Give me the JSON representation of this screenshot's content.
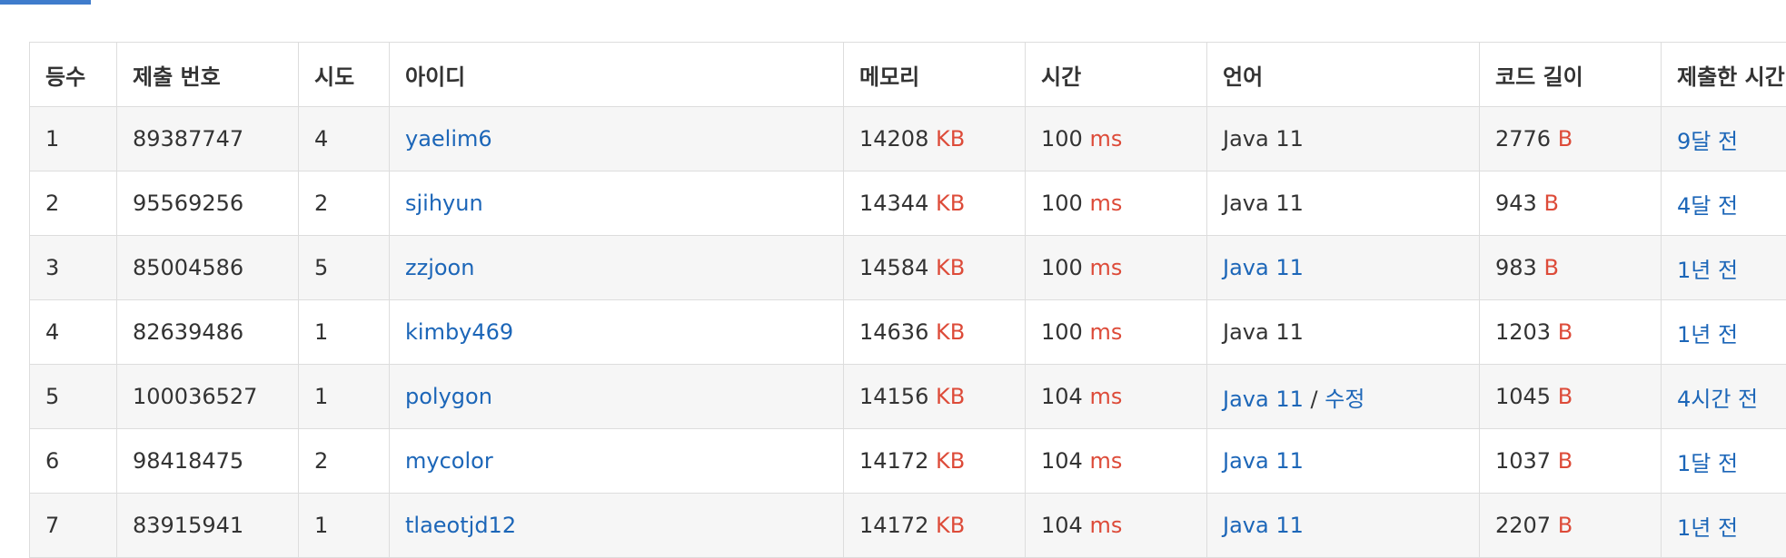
{
  "columns": {
    "rank": "등수",
    "submission_id": "제출 번호",
    "attempts": "시도",
    "user_id": "아이디",
    "memory": "메모리",
    "time": "시간",
    "language": "언어",
    "code_length": "코드 길이",
    "submitted_at": "제출한 시간"
  },
  "units": {
    "memory": "KB",
    "time": "ms",
    "length": "B"
  },
  "edit_label": "수정",
  "edit_separator": "/",
  "rows": [
    {
      "rank": "1",
      "submission_id": "89387747",
      "attempts": "4",
      "user_id": "yaelim6",
      "memory": "14208",
      "time": "100",
      "language": "Java 11",
      "language_linked": false,
      "editable": false,
      "code_length": "2776",
      "submitted_at": "9달 전"
    },
    {
      "rank": "2",
      "submission_id": "95569256",
      "attempts": "2",
      "user_id": "sjihyun",
      "memory": "14344",
      "time": "100",
      "language": "Java 11",
      "language_linked": false,
      "editable": false,
      "code_length": "943",
      "submitted_at": "4달 전"
    },
    {
      "rank": "3",
      "submission_id": "85004586",
      "attempts": "5",
      "user_id": "zzjoon",
      "memory": "14584",
      "time": "100",
      "language": "Java 11",
      "language_linked": true,
      "editable": false,
      "code_length": "983",
      "submitted_at": "1년 전"
    },
    {
      "rank": "4",
      "submission_id": "82639486",
      "attempts": "1",
      "user_id": "kimby469",
      "memory": "14636",
      "time": "100",
      "language": "Java 11",
      "language_linked": false,
      "editable": false,
      "code_length": "1203",
      "submitted_at": "1년 전"
    },
    {
      "rank": "5",
      "submission_id": "100036527",
      "attempts": "1",
      "user_id": "polygon",
      "memory": "14156",
      "time": "104",
      "language": "Java 11",
      "language_linked": true,
      "editable": true,
      "code_length": "1045",
      "submitted_at": "4시간 전"
    },
    {
      "rank": "6",
      "submission_id": "98418475",
      "attempts": "2",
      "user_id": "mycolor",
      "memory": "14172",
      "time": "104",
      "language": "Java 11",
      "language_linked": true,
      "editable": false,
      "code_length": "1037",
      "submitted_at": "1달 전"
    },
    {
      "rank": "7",
      "submission_id": "83915941",
      "attempts": "1",
      "user_id": "tlaeotjd12",
      "memory": "14172",
      "time": "104",
      "language": "Java 11",
      "language_linked": true,
      "editable": false,
      "code_length": "2207",
      "submitted_at": "1년 전"
    }
  ],
  "colors": {
    "link": "#1c66b8",
    "unit": "#dd4b39",
    "accent": "#3f7ccc"
  }
}
